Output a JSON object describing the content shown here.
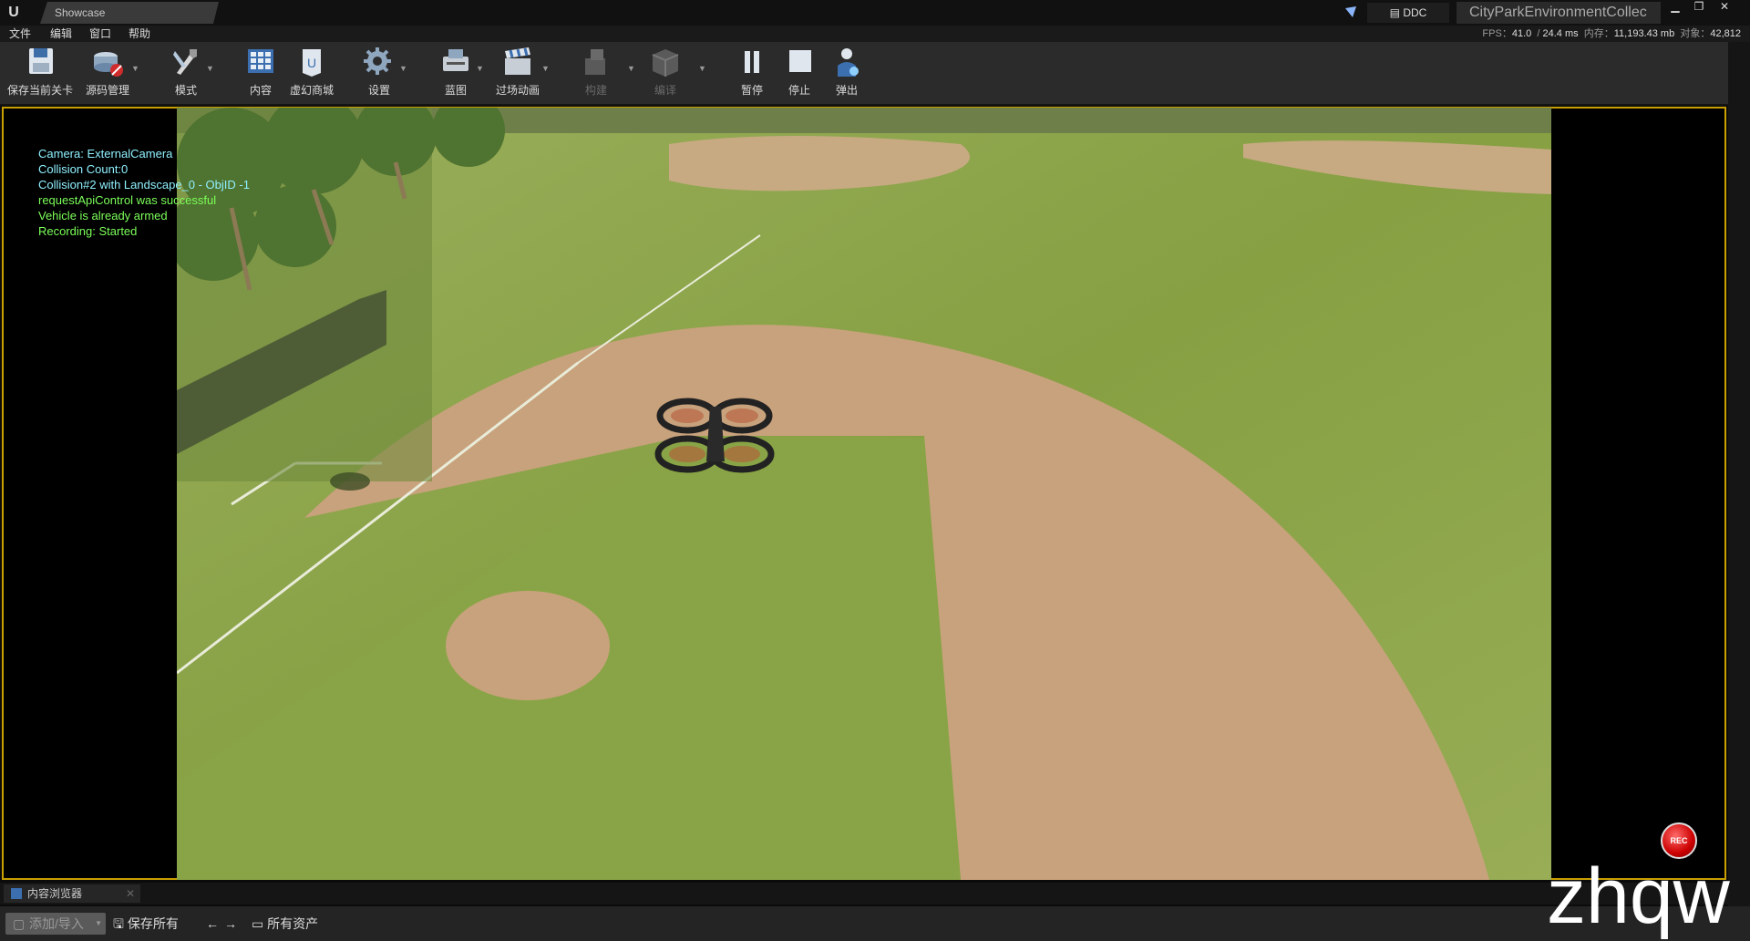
{
  "titlebar": {
    "tab_title": "Showcase",
    "ddc_label": "DDC",
    "project_name": "CityParkEnvironmentCollec"
  },
  "menu": [
    "文件",
    "编辑",
    "窗口",
    "帮助"
  ],
  "stats": {
    "fps_label": "FPS：",
    "fps": "41.0",
    "ms": "24.4 ms",
    "mem_label": "内存：",
    "mem": "11,193.43 mb",
    "obj_label": "对象：",
    "objects": "42,812"
  },
  "toolbar": {
    "save_level": "保存当前关卡",
    "source_control": "源码管理",
    "modes": "模式",
    "content": "内容",
    "marketplace": "虚幻商城",
    "settings": "设置",
    "blueprints": "蓝图",
    "cinematics": "过场动画",
    "build": "构建",
    "compile": "编译",
    "pause": "暂停",
    "stop": "停止",
    "eject": "弹出"
  },
  "viewport_log": [
    {
      "text": "Camera: ExternalCamera",
      "color": "#8ff0ff"
    },
    {
      "text": "Collision Count:0",
      "color": "#8ff0ff"
    },
    {
      "text": "Collision#2 with Landscape_0 - ObjID -1",
      "color": "#8ff0ff"
    },
    {
      "text": "requestApiControl was successful",
      "color": "#7cff5a"
    },
    {
      "text": "Vehicle is already armed",
      "color": "#7cff5a"
    },
    {
      "text": "Recording: Started",
      "color": "#7cff5a"
    }
  ],
  "rec_label": "REC",
  "watermark": "zhqw",
  "content_browser": {
    "tab_label": "内容浏览器",
    "add_import": "添加/导入",
    "save_all": "保存所有",
    "path": "所有资产"
  },
  "colors": {
    "viewport_border": "#c9a000",
    "grass": "#8fa850",
    "dirt": "#c8a27c"
  }
}
